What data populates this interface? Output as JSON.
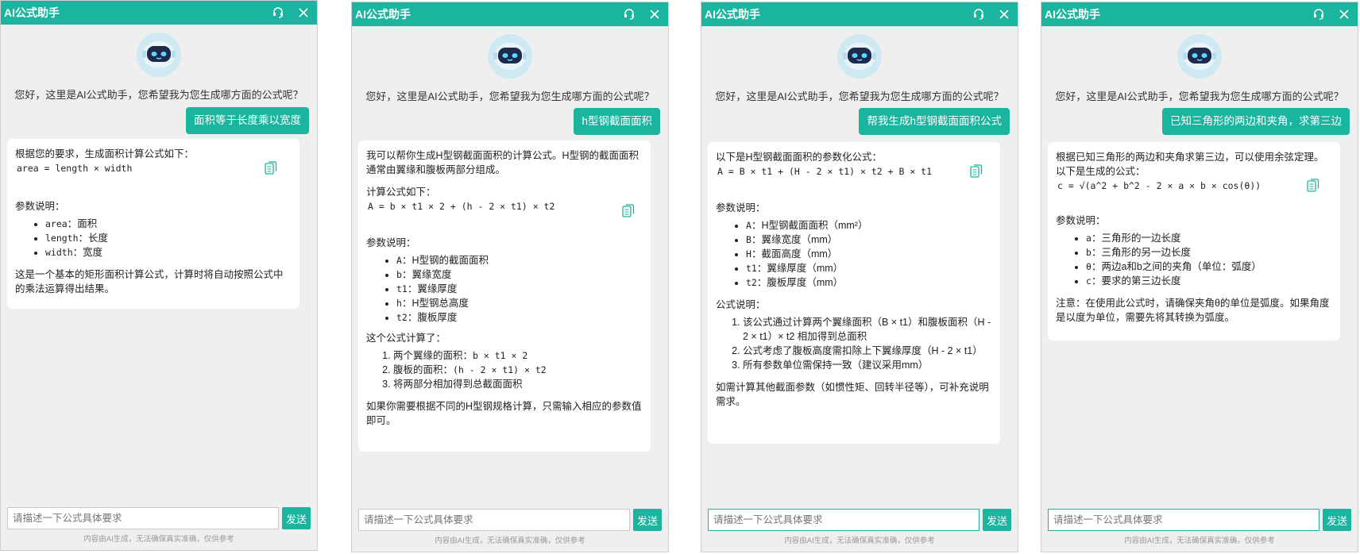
{
  "app_title": "AI公式助手",
  "greeting": "您好，这里是AI公式助手，您希望我为您生成哪方面的公式呢？",
  "input_placeholder": "请描述一下公式具体要求",
  "send_label": "发送",
  "disclaimer": "内容由AI生成，无法确保真实准确，仅供参考",
  "accent_color": "#1ab49f",
  "icons": {
    "support": "headset-icon",
    "close": "close-icon",
    "copy": "copy-icon",
    "avatar": "robot-icon"
  },
  "chat1": {
    "user": "面积等于长度乘以宽度",
    "intro": "根据您的要求，生成面积计算公式如下：",
    "formula": "area = length × width",
    "params_title": "参数说明：",
    "params": [
      {
        "code": "area",
        "desc": "：面积"
      },
      {
        "code": "length",
        "desc": "：长度"
      },
      {
        "code": "width",
        "desc": "：宽度"
      }
    ],
    "outro": "这是一个基本的矩形面积计算公式，计算时将自动按照公式中的乘法运算得出结果。"
  },
  "chat2": {
    "user": "h型钢截面面积",
    "intro": "我可以帮你生成H型钢截面面积的计算公式。H型钢的截面面积通常由翼缘和腹板两部分组成。",
    "formula_title": "计算公式如下：",
    "formula": "A = b × t1 × 2 + (h - 2 × t1) × t2",
    "params_title": "参数说明：",
    "params": [
      {
        "code": "A",
        "desc": "：H型钢的截面面积"
      },
      {
        "code": "b",
        "desc": "：翼缘宽度"
      },
      {
        "code": "t1",
        "desc": "：翼缘厚度"
      },
      {
        "code": "h",
        "desc": "：H型钢总高度"
      },
      {
        "code": "t2",
        "desc": "：腹板厚度"
      }
    ],
    "calc_title": "这个公式计算了：",
    "calc_items": [
      {
        "text": "两个翼缘的面积：",
        "code": "b × t1 × 2"
      },
      {
        "text": "腹板的面积：",
        "code": "(h - 2 × t1) × t2"
      },
      {
        "text": "将两部分相加得到总截面面积",
        "code": ""
      }
    ],
    "outro": "如果你需要根据不同的H型钢规格计算，只需输入相应的参数值即可。"
  },
  "chat3": {
    "user": "帮我生成h型钢截面面积公式",
    "intro": "以下是H型钢截面面积的参数化公式：",
    "formula": "A = B × t1 + (H - 2 × t1) × t2 + B × t1",
    "params_title": "参数说明：",
    "params": [
      {
        "code": "A",
        "desc": "：H型钢截面面积（mm²）"
      },
      {
        "code": "B",
        "desc": "：翼缘宽度（mm）"
      },
      {
        "code": "H",
        "desc": "：截面高度（mm）"
      },
      {
        "code": "t1",
        "desc": "：翼缘厚度（mm）"
      },
      {
        "code": "t2",
        "desc": "：腹板厚度（mm）"
      }
    ],
    "notes_title": "公式说明：",
    "notes": [
      "该公式通过计算两个翼缘面积（B × t1）和腹板面积（H - 2 × t1）× t2 相加得到总面积",
      "公式考虑了腹板高度需扣除上下翼缘厚度（H - 2 × t1）",
      "所有参数单位需保持一致（建议采用mm）"
    ],
    "outro": "如需计算其他截面参数（如惯性矩、回转半径等），可补充说明需求。"
  },
  "chat4": {
    "user": "已知三角形的两边和夹角，求第三边",
    "intro": "根据已知三角形的两边和夹角求第三边，可以使用余弦定理。以下是生成的公式：",
    "formula": "c = √(a^2 + b^2 - 2 × a × b × cos(θ))",
    "params_title": "参数说明：",
    "params": [
      {
        "code": "a",
        "desc": "：三角形的一边长度"
      },
      {
        "code": "b",
        "desc": "：三角形的另一边长度"
      },
      {
        "code": "θ",
        "desc": "：两边a和b之间的夹角（单位：弧度）"
      },
      {
        "code": "c",
        "desc": "：要求的第三边长度"
      }
    ],
    "outro": "注意：在使用此公式时，请确保夹角θ的单位是弧度。如果角度是以度为单位，需要先将其转换为弧度。"
  }
}
